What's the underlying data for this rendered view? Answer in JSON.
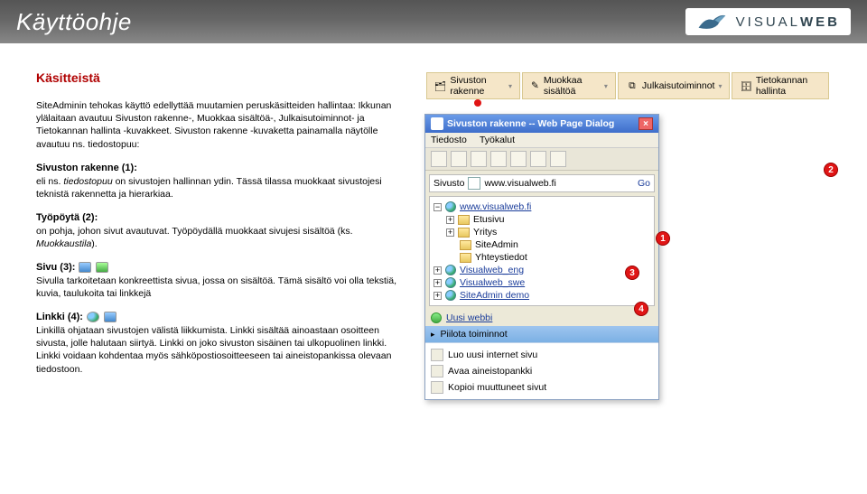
{
  "header": {
    "title": "Käyttöohje",
    "brand": "VISUALWEB"
  },
  "doc": {
    "heading": "Käsitteistä",
    "intro": "SiteAdminin tehokas käyttö edellyttää muutamien peruskäsitteiden hallintaa: Ikkunan ylälaitaan avautuu Sivuston rakenne-, Muokkaa sisältöä-, Julkaisutoiminnot- ja Tietokannan hallinta -kuvakkeet. Sivuston rakenne -kuvaketta painamalla näytölle avautuu ns. tiedostopuu:",
    "s1_head": "Sivuston rakenne (1):",
    "s1_body": "eli ns. tiedostopuu on sivustojen hallinnan ydin. Tässä tilassa muokkaat sivustojesi teknistä rakennetta ja hierarkiaa.",
    "s2_head": "Työpöytä (2):",
    "s2_body": "on pohja, johon sivut avautuvat. Työpöydällä muokkaat sivujesi sisältöä (ks. Muokkaustila).",
    "s3_head": "Sivu (3):",
    "s3_body": "Sivulla tarkoitetaan konkreettista sivua, jossa on sisältöä. Tämä sisältö voi olla tekstiä, kuvia, taulukoita tai linkkejä",
    "s4_head": "Linkki (4):",
    "s4_body": "Linkillä ohjataan sivustojen välistä liikkumista. Linkki sisältää ainoastaan osoitteen sivusta, jolle halutaan siirtyä. Linkki on joko sivuston sisäinen tai ulkopuolinen linkki. Linkki voidaan kohdentaa myös sähköpostiosoitteeseen tai aineistopankissa olevaan tiedostoon."
  },
  "tabs": {
    "t1": "Sivuston rakenne",
    "t2": "Muokkaa sisältöä",
    "t3": "Julkaisutoiminnot",
    "t4": "Tietokannan hallinta"
  },
  "dialog": {
    "title": "Sivuston rakenne -- Web Page Dialog",
    "menu_file": "Tiedosto",
    "menu_tools": "Työkalut",
    "site_label": "Sivusto",
    "site_value": "www.visualweb.fi",
    "go": "Go"
  },
  "tree": {
    "root": "www.visualweb.fi",
    "n1": "Etusivu",
    "n2": "Yritys",
    "n3": "SiteAdmin",
    "n4": "Yhteystiedot",
    "n5": "Visualweb_eng",
    "n6": "Visualweb_swe",
    "n7": "SiteAdmin demo",
    "new": "Uusi webbi"
  },
  "panel": {
    "head": "Piilota toiminnot",
    "r1": "Luo uusi internet sivu",
    "r2": "Avaa aineistopankki",
    "r3": "Kopioi muuttuneet sivut"
  },
  "badges": {
    "b1": "1",
    "b2": "2",
    "b3": "3",
    "b4": "4"
  }
}
